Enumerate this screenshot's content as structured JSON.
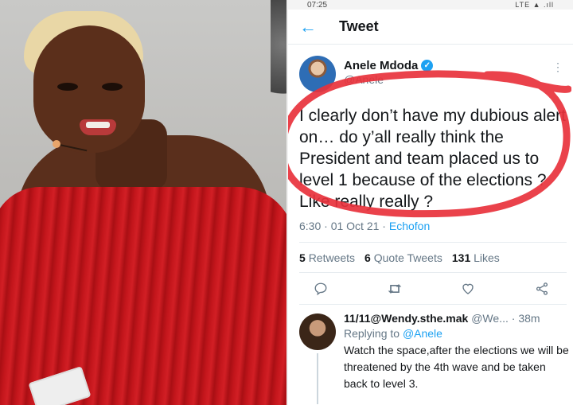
{
  "status_bar": {
    "time": "07:25",
    "indicators": "LTE ▲ .ıll"
  },
  "header": {
    "title": "Tweet",
    "back_icon": "arrow-left-icon"
  },
  "tweet": {
    "author_name": "Anele Mdoda",
    "author_handle": "@Anele",
    "verified": true,
    "text": "I clearly don’t have my dubious alert on… do y’all really think the President and team placed us to level 1 because of the elections ? Like really really ?",
    "time": "6:30",
    "date": "01 Oct 21",
    "source": "Echofon",
    "retweets": "5",
    "retweets_label": "Retweets",
    "quote_tweets": "6",
    "quote_tweets_label": "Quote Tweets",
    "likes": "131",
    "likes_label": "Likes"
  },
  "reply": {
    "name": "11/11@Wendy.sthe.mak",
    "handle": "@We...",
    "time": "38m",
    "replying_to_label": "Replying to",
    "replying_to": "@Anele",
    "text": "Watch the space,after the elections we will be threatened by the 4th wave and be taken back to level 3."
  },
  "colors": {
    "accent": "#1da1f2",
    "annotation_circle": "#e8323c",
    "dress": "#c4161c"
  }
}
